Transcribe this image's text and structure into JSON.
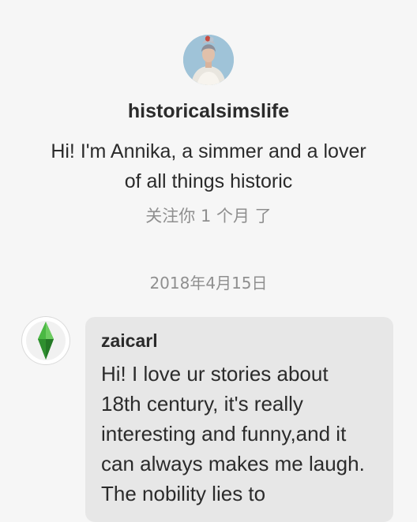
{
  "profile": {
    "username": "historicalsimslife",
    "bio": "Hi! I'm Annika, a simmer and a lover of all things historic",
    "follow_status": "关注你 1 个月 了"
  },
  "conversation": {
    "date": "2018年4月15日",
    "messages": [
      {
        "sender": "zaicarl",
        "text": "Hi! I love ur stories about 18th century, it's really interesting and funny,and it can always makes me laugh. The nobility lies to"
      }
    ]
  },
  "colors": {
    "background": "#f6f6f6",
    "bubble": "#e7e7e7",
    "primary_text": "#2b2b2b",
    "secondary_text": "#8f8f8f",
    "plumbob_green": "#3fae3a"
  },
  "icons": {
    "profile_avatar": "historical-portrait-avatar",
    "sender_avatar": "green-plumbob-avatar"
  }
}
